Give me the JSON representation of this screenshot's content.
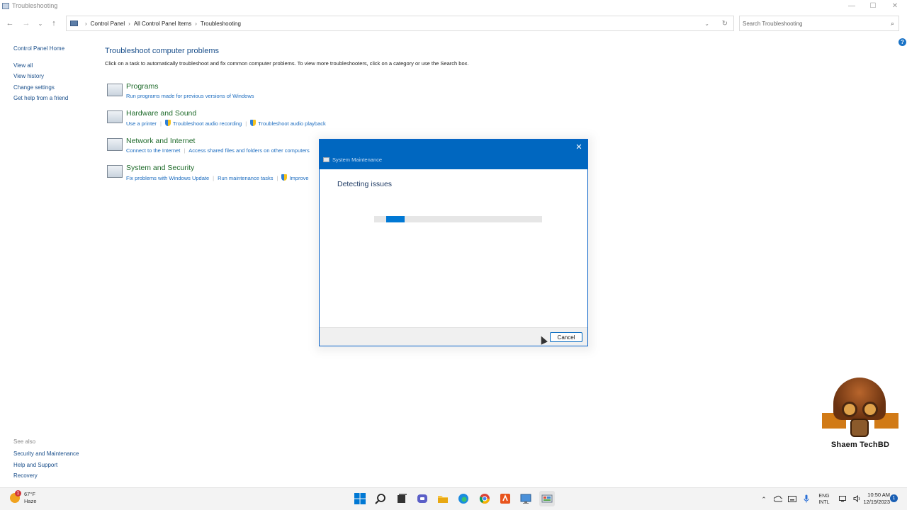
{
  "window": {
    "title": "Troubleshooting",
    "minimize": "—",
    "maximize": "☐",
    "close": "✕"
  },
  "nav": {
    "back": "←",
    "forward": "→",
    "recent": "⌄",
    "up": "↑"
  },
  "address": {
    "crumbs": [
      "Control Panel",
      "All Control Panel Items",
      "Troubleshooting"
    ],
    "separator": "›",
    "dropdown": "⌄",
    "refresh": "↻"
  },
  "search": {
    "placeholder": "Search Troubleshooting",
    "icon": "⌕"
  },
  "help": {
    "label": "?"
  },
  "sidebar": {
    "home": "Control Panel Home",
    "links": [
      "View all",
      "View history",
      "Change settings",
      "Get help from a friend"
    ]
  },
  "seealso": {
    "title": "See also",
    "links": [
      "Security and Maintenance",
      "Help and Support",
      "Recovery"
    ]
  },
  "main": {
    "title": "Troubleshoot computer problems",
    "description": "Click on a task to automatically troubleshoot and fix common computer problems. To view more troubleshooters, click on a category or use the Search box.",
    "categories": [
      {
        "title": "Programs",
        "links": [
          "Run programs made for previous versions of Windows"
        ]
      },
      {
        "title": "Hardware and Sound",
        "links": [
          "Use a printer",
          "Troubleshoot audio recording",
          "Troubleshoot audio playback"
        ]
      },
      {
        "title": "Network and Internet",
        "links": [
          "Connect to the Internet",
          "Access shared files and folders on other computers"
        ]
      },
      {
        "title": "System and Security",
        "links": [
          "Fix problems with Windows Update",
          "Run maintenance tasks",
          "Improve"
        ]
      }
    ]
  },
  "dialog": {
    "title": "System Maintenance",
    "close": "✕",
    "heading": "Detecting issues",
    "progress_pct": 11,
    "cancel": "Cancel",
    "accent": "#0067c0"
  },
  "watermark": {
    "text": "Shaem TechBD"
  },
  "taskbar": {
    "weather": {
      "temp": "67°F",
      "cond": "Haze",
      "badge": "1"
    },
    "apps": [
      "start-icon",
      "search-icon",
      "task-view-icon",
      "teams-icon",
      "file-explorer-icon",
      "edge-icon",
      "chrome-icon",
      "app-icon",
      "remote-desktop-icon",
      "control-panel-icon"
    ],
    "tray": {
      "chevron": "⌃",
      "lang_top": "ENG",
      "lang_bottom": "INTL"
    },
    "clock": {
      "time": "10:50 AM",
      "date": "12/19/2023"
    },
    "notifications": "1"
  }
}
